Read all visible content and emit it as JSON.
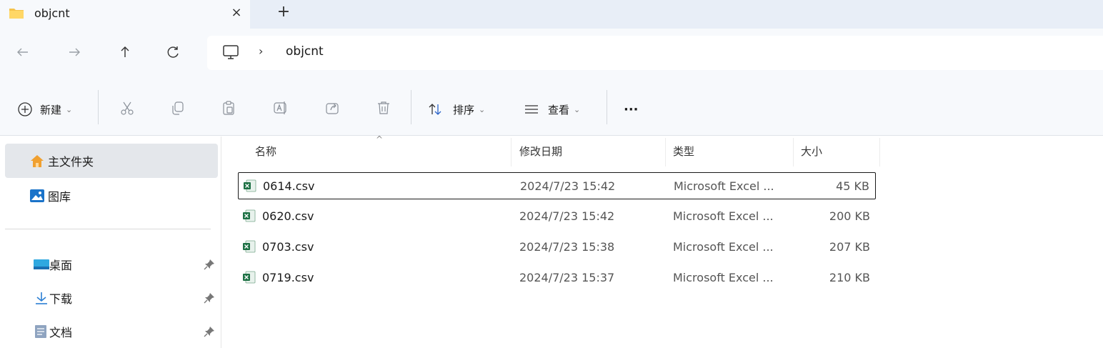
{
  "tab": {
    "title": "objcnt",
    "close_label": "×",
    "new_tab_label": "+"
  },
  "address": {
    "separator": "›",
    "crumbs": [
      "objcnt"
    ]
  },
  "nav_icons": [
    "back-icon",
    "forward-icon",
    "up-icon",
    "refresh-icon"
  ],
  "toolbar": {
    "new_label": "新建",
    "sort_label": "排序",
    "view_label": "查看",
    "more_label": "···"
  },
  "sidebar": {
    "items": [
      {
        "label": "主文件夹",
        "icon": "home-icon",
        "pinned": false
      },
      {
        "label": "图库",
        "icon": "gallery-icon",
        "pinned": false
      },
      {
        "label": "桌面",
        "icon": "desktop-icon",
        "pinned": true
      },
      {
        "label": "下载",
        "icon": "download-icon",
        "pinned": true
      },
      {
        "label": "文档",
        "icon": "documents-icon",
        "pinned": true
      }
    ]
  },
  "file_list": {
    "headers": {
      "name": "名称",
      "date": "修改日期",
      "type": "类型",
      "size": "大小"
    },
    "sort_indicator": "^",
    "rows": [
      {
        "name": "0614.csv",
        "date": "2024/7/23 15:42",
        "type": "Microsoft Excel ...",
        "size": "45 KB"
      },
      {
        "name": "0620.csv",
        "date": "2024/7/23 15:42",
        "type": "Microsoft Excel ...",
        "size": "200 KB"
      },
      {
        "name": "0703.csv",
        "date": "2024/7/23 15:38",
        "type": "Microsoft Excel ...",
        "size": "207 KB"
      },
      {
        "name": "0719.csv",
        "date": "2024/7/23 15:37",
        "type": "Microsoft Excel ...",
        "size": "210 KB"
      }
    ]
  },
  "colors": {
    "chrome_bg": "#f7f9fc",
    "tabstrip_bg": "#e8eef7",
    "selected_bg": "#e4e7eb",
    "excel_green": "#1e7145",
    "folder_yellow": "#f5c34b"
  }
}
